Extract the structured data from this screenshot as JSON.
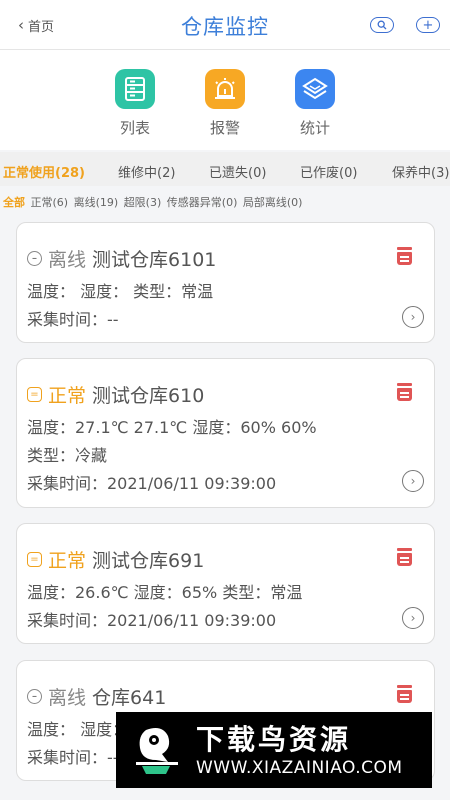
{
  "header": {
    "back_label": "首页",
    "title": "仓库监控"
  },
  "quick_actions": [
    {
      "label": "列表",
      "icon": "list-icon",
      "color": "#2ec4a5"
    },
    {
      "label": "报警",
      "icon": "alarm-icon",
      "color": "#f7a824"
    },
    {
      "label": "统计",
      "icon": "stats-icon",
      "color": "#3c86f0"
    }
  ],
  "tabs": [
    "正常使用(28)",
    "维修中(2)",
    "已遗失(0)",
    "已作废(0)",
    "保养中(3)"
  ],
  "filters": [
    "全部",
    "正常(6)",
    "离线(19)",
    "超限(3)",
    "传感器异常(0)",
    "局部离线(0)"
  ],
  "cards": [
    {
      "status": "离线",
      "name": "测试仓库6101",
      "line1": "温度：  湿度：  类型：常温",
      "line2": "采集时间：--"
    },
    {
      "status": "正常",
      "name": "测试仓库610",
      "line1": "温度：27.1℃ 27.1℃  湿度：60% 60%",
      "line2": "类型：冷藏",
      "line3": "采集时间：2021/06/11 09:39:00"
    },
    {
      "status": "正常",
      "name": "测试仓库691",
      "line1": "温度：26.6℃  湿度：65%  类型：常温",
      "line2": "采集时间：2021/06/11 09:39:00"
    },
    {
      "status": "离线",
      "name": "仓库641",
      "line1": "温度：  湿度：",
      "line2": "采集时间：--"
    }
  ],
  "watermark": {
    "title": "下载鸟资源",
    "url": "WWW.XIAZAINIAO.COM"
  },
  "colors": {
    "accent": "#f0a21e",
    "title": "#3d7fd9",
    "danger": "#e05555"
  }
}
